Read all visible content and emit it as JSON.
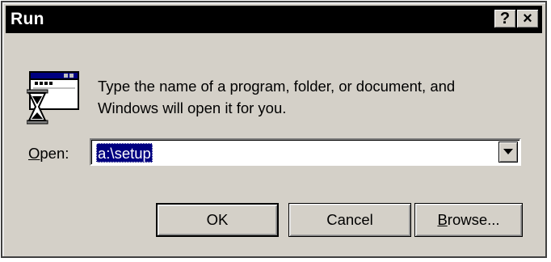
{
  "window": {
    "title": "Run",
    "help_button": "?",
    "close_button": "×"
  },
  "icons": {
    "run": "run-program-icon",
    "help": "help-icon",
    "close": "close-icon",
    "dropdown": "chevron-down-icon"
  },
  "description": {
    "line1": "Type the name of a program, folder, or document, and",
    "line2": "Windows will open it for you."
  },
  "open_field": {
    "label_underlined": "O",
    "label_rest": "pen:",
    "value": "a:\\setup"
  },
  "buttons": {
    "ok": "OK",
    "cancel": "Cancel",
    "browse_underlined": "B",
    "browse_rest": "rowse..."
  },
  "colors": {
    "title_bar": "#000000",
    "face": "#d4d0c8",
    "selection": "#000080"
  }
}
